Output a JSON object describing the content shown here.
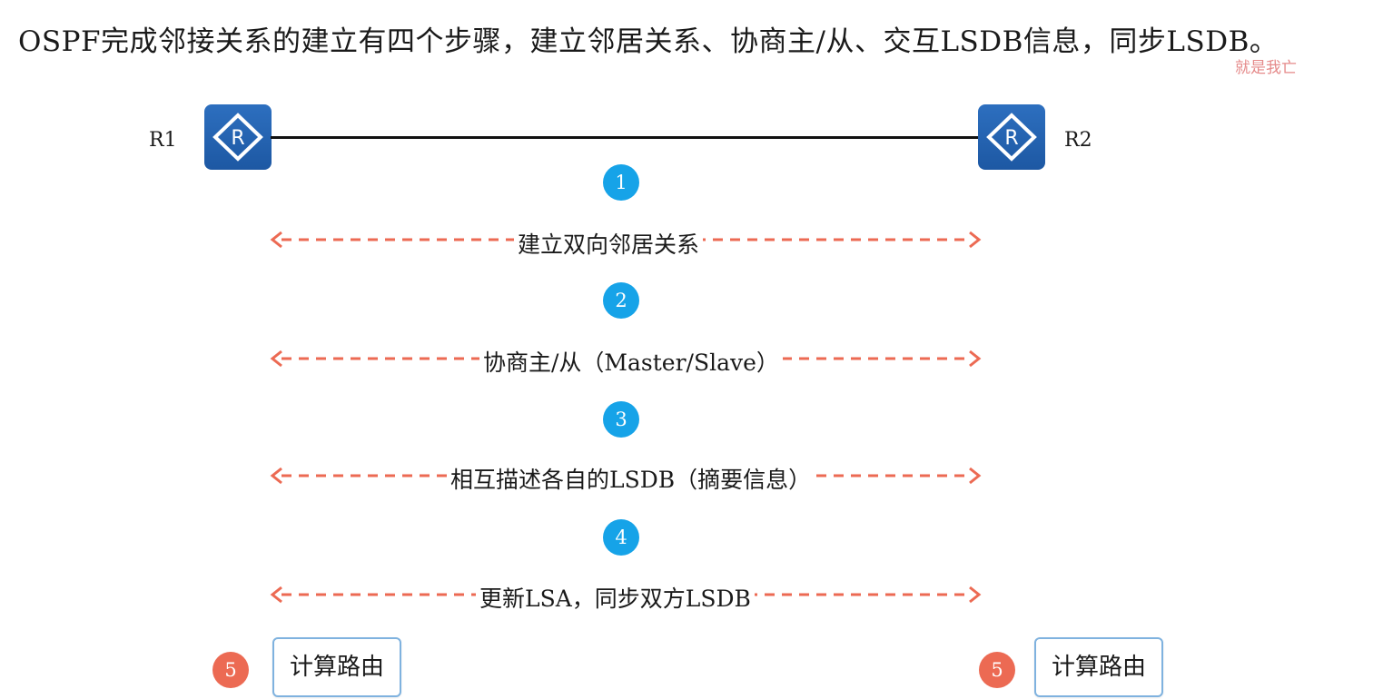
{
  "title": "OSPF完成邻接关系的建立有四个步骤，建立邻居关系、协商主/从、交互LSDB信息，同步LSDB。",
  "watermark": "就是我亡",
  "routers": [
    {
      "label": "R1",
      "icon": "router-icon"
    },
    {
      "label": "R2",
      "icon": "router-icon"
    }
  ],
  "steps": [
    {
      "number": "1",
      "text": "建立双向邻居关系"
    },
    {
      "number": "2",
      "text": "协商主/从（Master/Slave）"
    },
    {
      "number": "3",
      "text": "相互描述各自的LSDB（摘要信息）"
    },
    {
      "number": "4",
      "text": "更新LSA，同步双方LSDB"
    }
  ],
  "final": {
    "number": "5",
    "left_label": "计算路由",
    "right_label": "计算路由"
  },
  "colors": {
    "router": "#1d58a3",
    "step_badge": "#16a3e8",
    "final_badge": "#ec6a53",
    "arrow": "#ec6a53",
    "box_border": "#7fb2df"
  }
}
